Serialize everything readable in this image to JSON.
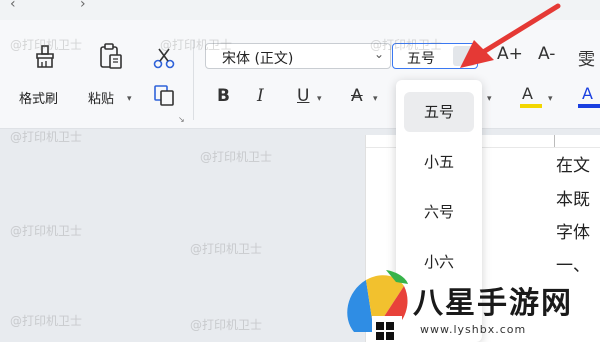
{
  "ribbon": {
    "format_painter_label": "格式刷",
    "paste_label": "粘贴",
    "font_name": "宋体 (正文)",
    "font_size": "五号",
    "bold_glyph": "B",
    "italic_glyph": "I",
    "underline_glyph": "U",
    "strike_glyph": "A",
    "grow_font_glyph": "A+",
    "shrink_font_glyph": "A-",
    "phonetic_glyph": "雯",
    "highlight_glyph": "A",
    "font_color_glyph": "A"
  },
  "font_size_dropdown": {
    "items": [
      "五号",
      "小五",
      "六号",
      "小六"
    ],
    "selected": "五号"
  },
  "document": {
    "lines": [
      "在文",
      "本既",
      "字体",
      "一、"
    ]
  },
  "watermark": "@打印机卫士",
  "logo": {
    "title": "八星手游网",
    "url": "www.lyshbx.com"
  },
  "colors": {
    "annotation_arrow": "#e53935",
    "highlight_bar": "#f2d600",
    "font_color_bar": "#1a3fe0",
    "combo_active_border": "#3a78f2"
  }
}
